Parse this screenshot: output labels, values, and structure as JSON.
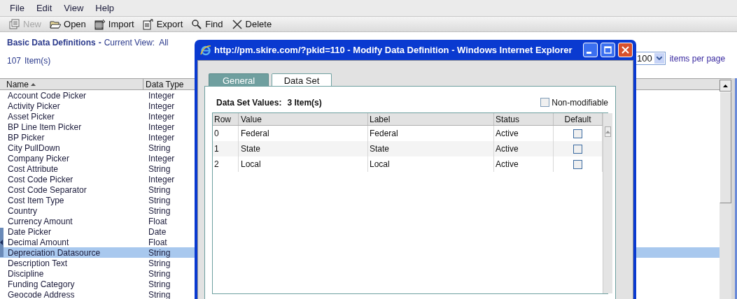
{
  "menu": [
    "File",
    "Edit",
    "View",
    "Help"
  ],
  "toolbar": [
    {
      "kind": "new",
      "label": "New",
      "disabled": true
    },
    {
      "kind": "open",
      "label": "Open",
      "disabled": false
    },
    {
      "kind": "import",
      "label": "Import",
      "disabled": false
    },
    {
      "kind": "export",
      "label": "Export",
      "disabled": false
    },
    {
      "kind": "find",
      "label": "Find",
      "disabled": false
    },
    {
      "kind": "delete",
      "label": "Delete",
      "disabled": false
    }
  ],
  "header": {
    "title": "Basic Data Definitions",
    "separator": "-",
    "view_label": "Current View:",
    "view": "All",
    "count": "107",
    "count_label": "Item(s)"
  },
  "pager": {
    "value": "100",
    "label": "items per page"
  },
  "table": {
    "columns": [
      {
        "label": "Name",
        "sorted": true
      },
      {
        "label": "Data Type",
        "sorted": false
      }
    ],
    "rows": [
      {
        "name": "Account Code Picker",
        "type": "Integer",
        "selected": false
      },
      {
        "name": "Activity Picker",
        "type": "Integer",
        "selected": false
      },
      {
        "name": "Asset Picker",
        "type": "Integer",
        "selected": false
      },
      {
        "name": "BP Line Item Picker",
        "type": "Integer",
        "selected": false
      },
      {
        "name": "BP Picker",
        "type": "Integer",
        "selected": false
      },
      {
        "name": "City PullDown",
        "type": "String",
        "selected": false
      },
      {
        "name": "Company Picker",
        "type": "Integer",
        "selected": false
      },
      {
        "name": "Cost Attribute",
        "type": "String",
        "selected": false
      },
      {
        "name": "Cost Code Picker",
        "type": "Integer",
        "selected": false
      },
      {
        "name": "Cost Code Separator",
        "type": "String",
        "selected": false
      },
      {
        "name": "Cost Item Type",
        "type": "String",
        "selected": false
      },
      {
        "name": "Country",
        "type": "String",
        "selected": false
      },
      {
        "name": "Currency Amount",
        "type": "Float",
        "selected": false
      },
      {
        "name": "Date Picker",
        "type": "Date",
        "selected": false
      },
      {
        "name": "Decimal Amount",
        "type": "Float",
        "selected": false
      },
      {
        "name": "Depreciation Datasource",
        "type": "String",
        "selected": true
      },
      {
        "name": "Description Text",
        "type": "String",
        "selected": false
      },
      {
        "name": "Discipline",
        "type": "String",
        "selected": false
      },
      {
        "name": "Funding Category",
        "type": "String",
        "selected": false
      },
      {
        "name": "Geocode Address",
        "type": "String",
        "selected": false
      }
    ]
  },
  "dialog": {
    "title": "http://pm.skire.com/?pkid=110 - Modify Data Definition - Windows Internet Explorer",
    "tabs": [
      {
        "label": "General",
        "selected": false
      },
      {
        "label": "Data Set",
        "selected": true
      }
    ],
    "summary_label": "Data Set Values:",
    "summary_count": "3 Item(s)",
    "non_modifiable": {
      "label": "Non-modifiable",
      "checked": false
    },
    "grid": {
      "columns": [
        "Row",
        "Value",
        "Label",
        "Status",
        "Default"
      ],
      "rows": [
        {
          "row": "0",
          "value": "Federal",
          "label": "Federal",
          "status": "Active",
          "default": false
        },
        {
          "row": "1",
          "value": "State",
          "label": "State",
          "status": "Active",
          "default": false
        },
        {
          "row": "2",
          "value": "Local",
          "label": "Local",
          "status": "Active",
          "default": false
        }
      ]
    }
  }
}
